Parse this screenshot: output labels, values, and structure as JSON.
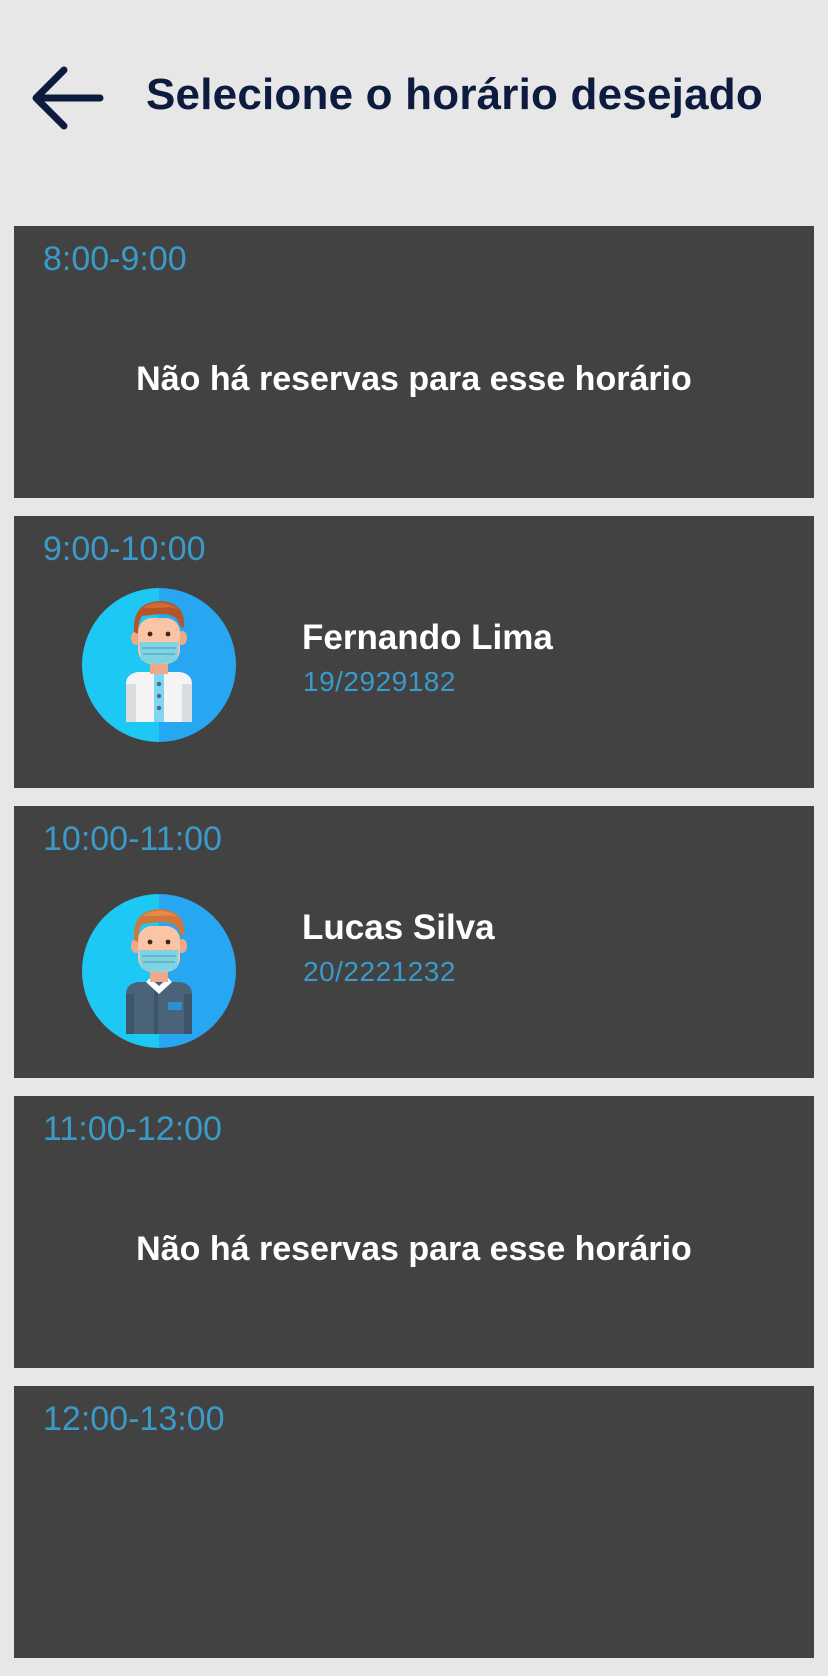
{
  "header": {
    "title": "Selecione o horário desejado",
    "back_icon": "arrow-left-icon"
  },
  "colors": {
    "background": "#e7e7e7",
    "card": "#424242",
    "title": "#0d1b3e",
    "accent": "#3a9ac9"
  },
  "slots": [
    {
      "time": "8:00-9:00",
      "empty_text": "Não há reservas para esse horário"
    },
    {
      "time": "9:00-10:00",
      "name": "Fernando Lima",
      "id": "19/2929182",
      "avatar_icon": "doctor-masked-avatar-icon"
    },
    {
      "time": "10:00-11:00",
      "name": "Lucas Silva",
      "id": "20/2221232",
      "avatar_icon": "man-masked-avatar-icon"
    },
    {
      "time": "11:00-12:00",
      "empty_text": "Não há reservas para esse horário"
    },
    {
      "time": "12:00-13:00"
    }
  ]
}
